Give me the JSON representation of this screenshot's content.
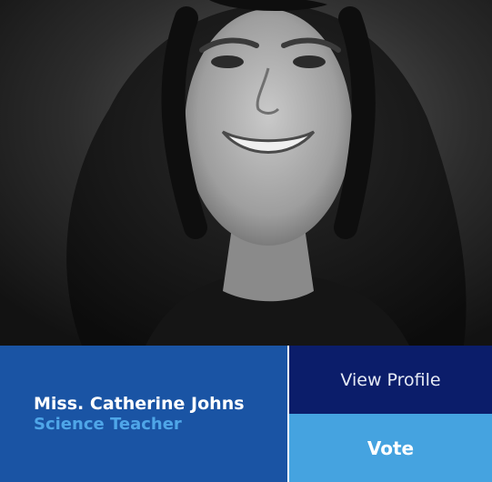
{
  "profile": {
    "name": "Miss. Catherine Johns",
    "role": "Science Teacher",
    "photo_alt": "Portrait photo"
  },
  "actions": {
    "view_profile_label": "View Profile",
    "vote_label": "Vote"
  },
  "colors": {
    "info_background": "#1a54a4",
    "role_text": "#4fa6e8",
    "view_profile_background": "#0b1d6a",
    "vote_background": "#45a3e0"
  },
  "icons": [
    "portrait-photo"
  ]
}
